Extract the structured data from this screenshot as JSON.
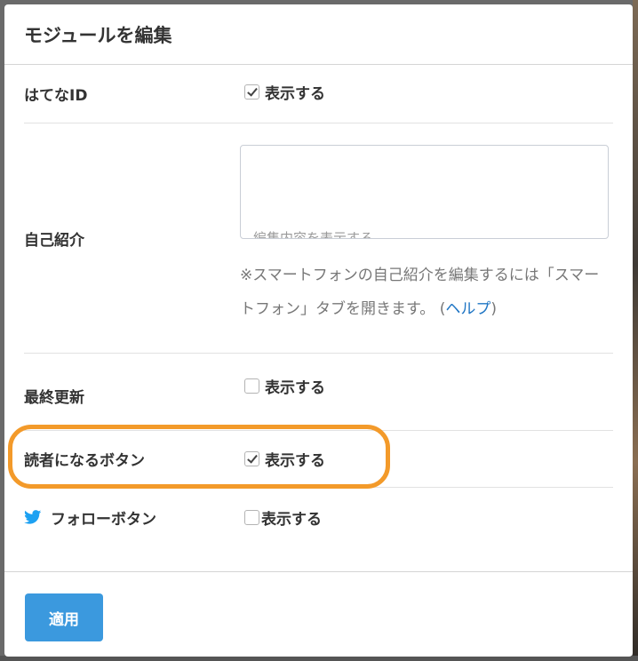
{
  "modal": {
    "title": "モジュールを編集"
  },
  "rows": {
    "hatena_id": {
      "label": "はてなID",
      "show_label": "表示する",
      "checked": true
    },
    "profile": {
      "label": "自己紹介",
      "textarea_overflow_text": "編集内容を表示する",
      "help_text": "※スマートフォンの自己紹介を編集するには「スマートフォン」タブを開きます。 (",
      "help_link": "ヘルプ",
      "help_close": ")"
    },
    "last_updated": {
      "label": "最終更新",
      "show_label": "表示する",
      "checked": false
    },
    "reader_button": {
      "label": "読者になるボタン",
      "show_label": "表示する",
      "checked": true
    },
    "follow_button": {
      "label": "フォローボタン",
      "show_label": "表示する",
      "checked": false,
      "icon": "twitter-icon"
    }
  },
  "footer": {
    "apply_label": "適用"
  },
  "colors": {
    "primary_button": "#3b99de",
    "highlight": "#f39a2a",
    "link": "#1e75c4",
    "twitter": "#1da1f2"
  }
}
